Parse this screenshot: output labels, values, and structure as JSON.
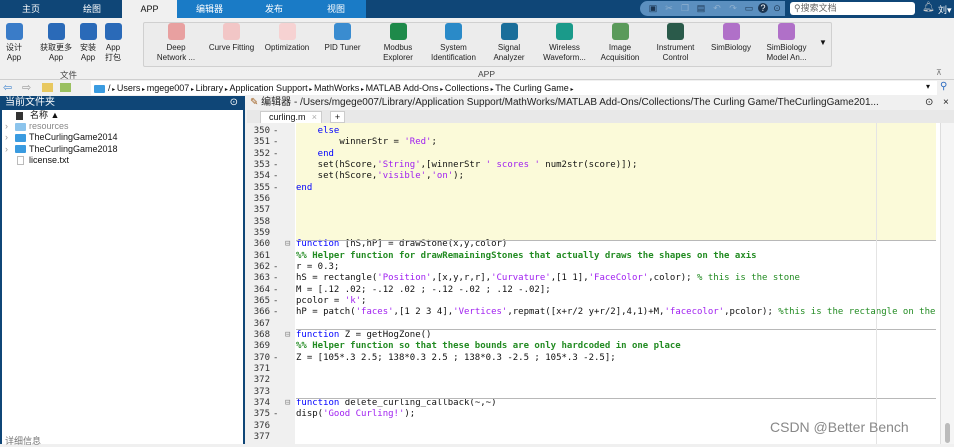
{
  "tabs": {
    "items": [
      "主页",
      "绘图",
      "APP",
      "编辑器",
      "发布",
      "视图"
    ],
    "active": "APP"
  },
  "quick_access": {
    "icons": [
      "save-icon",
      "cut-icon",
      "copy-icon",
      "paste-icon",
      "undo-icon",
      "redo-icon",
      "switch-windows-icon",
      "help-icon",
      "dropdown-icon"
    ]
  },
  "search": {
    "placeholder": "搜索文档"
  },
  "user": {
    "name": "刘"
  },
  "ribbon": {
    "file_group": {
      "label": "文件",
      "buttons": [
        [
          "设计",
          "App"
        ],
        [
          "获取更多 App",
          ""
        ],
        [
          "安装",
          "App"
        ],
        [
          "App",
          "打包"
        ]
      ]
    },
    "app_group": {
      "label": "APP",
      "apps": [
        {
          "l1": "Deep",
          "l2": "Network ...",
          "color": "#e8a0a0"
        },
        {
          "l1": "Curve Fitting",
          "l2": "",
          "color": "#f2c6c6"
        },
        {
          "l1": "Optimization",
          "l2": "",
          "color": "#f6d2d2"
        },
        {
          "l1": "PID Tuner",
          "l2": "",
          "color": "#3a8cd0"
        },
        {
          "l1": "Modbus",
          "l2": "Explorer",
          "color": "#1e8a4a"
        },
        {
          "l1": "System",
          "l2": "Identification",
          "color": "#2a8ac8"
        },
        {
          "l1": "Signal",
          "l2": "Analyzer",
          "color": "#1a6e9a"
        },
        {
          "l1": "Wireless",
          "l2": "Waveform...",
          "color": "#1a9a8a"
        },
        {
          "l1": "Image",
          "l2": "Acquisition",
          "color": "#5a9a5a"
        },
        {
          "l1": "Instrument",
          "l2": "Control",
          "color": "#2a5a4a"
        },
        {
          "l1": "SimBiology",
          "l2": "",
          "color": "#b070c8"
        },
        {
          "l1": "SimBiology",
          "l2": "Model An...",
          "color": "#b070c8"
        }
      ]
    }
  },
  "address": {
    "path": [
      "/",
      "Users",
      "mgege007",
      "Library",
      "Application Support",
      "MathWorks",
      "MATLAB Add-Ons",
      "Collections",
      "The Curling Game"
    ]
  },
  "current_folder": {
    "title": "当前文件夹",
    "column": "名称 ▲",
    "items": [
      {
        "name": "resources",
        "type": "folder",
        "dim": true
      },
      {
        "name": "TheCurlingGame2014",
        "type": "folder"
      },
      {
        "name": "TheCurlingGame2018",
        "type": "folder"
      },
      {
        "name": "license.txt",
        "type": "file"
      }
    ],
    "details_label": "详细信息"
  },
  "editor": {
    "title": "编辑器 - /Users/mgege007/Library/Application Support/MathWorks/MATLAB Add-Ons/Collections/The Curling Game/TheCurlingGame201...",
    "tab": "curling.m",
    "add_tab": "+",
    "lines": [
      {
        "n": "350",
        "d": true,
        "t": [
          [
            "kw",
            "    else"
          ]
        ]
      },
      {
        "n": "351",
        "d": true,
        "t": [
          [
            "",
            "        winnerStr = "
          ],
          [
            "str",
            "'Red'"
          ],
          [
            "",
            ";"
          ]
        ]
      },
      {
        "n": "352",
        "d": true,
        "t": [
          [
            "kw",
            "    end"
          ]
        ]
      },
      {
        "n": "353",
        "d": true,
        "t": [
          [
            "",
            "    set(hScore,"
          ],
          [
            "str",
            "'String'"
          ],
          [
            "",
            ",[winnerStr "
          ],
          [
            "str",
            "' scores '"
          ],
          [
            "",
            " num2str(score)]);"
          ]
        ]
      },
      {
        "n": "354",
        "d": true,
        "t": [
          [
            "",
            "    set(hScore,"
          ],
          [
            "str",
            "'visible'"
          ],
          [
            "",
            ","
          ],
          [
            "str",
            "'on'"
          ],
          [
            "",
            ");"
          ]
        ]
      },
      {
        "n": "355",
        "d": true,
        "t": [
          [
            "kw",
            "end"
          ]
        ]
      },
      {
        "n": "356",
        "d": false,
        "t": []
      },
      {
        "n": "357",
        "d": false,
        "t": []
      },
      {
        "n": "358",
        "d": false,
        "t": []
      },
      {
        "n": "359",
        "d": false,
        "t": []
      },
      {
        "n": "360",
        "d": false,
        "t": [
          [
            "kw",
            "function"
          ],
          [
            "",
            " [hS,hP] = drawStone(x,y,color)"
          ]
        ]
      },
      {
        "n": "361",
        "d": false,
        "t": [
          [
            "cmb",
            "%% Helper function for drawRemainingStones that actually draws the shapes on the axis"
          ]
        ]
      },
      {
        "n": "362",
        "d": true,
        "t": [
          [
            "",
            "r = 0.3;"
          ]
        ]
      },
      {
        "n": "363",
        "d": true,
        "t": [
          [
            "",
            "hS = rectangle("
          ],
          [
            "str",
            "'Position'"
          ],
          [
            "",
            ",[x,y,r,r],"
          ],
          [
            "str",
            "'Curvature'"
          ],
          [
            "",
            ",[1 1],"
          ],
          [
            "str",
            "'FaceColor'"
          ],
          [
            "",
            ",color); "
          ],
          [
            "cm",
            "% this is the stone"
          ]
        ]
      },
      {
        "n": "364",
        "d": true,
        "t": [
          [
            "",
            "M = [.12 .02; -.12 .02 ; -.12 -.02 ; .12 -.02];"
          ]
        ]
      },
      {
        "n": "365",
        "d": true,
        "t": [
          [
            "",
            "pcolor = "
          ],
          [
            "str",
            "'k'"
          ],
          [
            "",
            ";"
          ]
        ]
      },
      {
        "n": "366",
        "d": true,
        "t": [
          [
            "",
            "hP = patch("
          ],
          [
            "str",
            "'faces'"
          ],
          [
            "",
            ",[1 2 3 4],"
          ],
          [
            "str",
            "'Vertices'"
          ],
          [
            "",
            ",repmat([x+r/2 y+r/2],4,1)+M,"
          ],
          [
            "str",
            "'facecolor'"
          ],
          [
            "",
            ",pcolor); "
          ],
          [
            "cm",
            "%this is the rectangle on the st"
          ]
        ]
      },
      {
        "n": "367",
        "d": false,
        "t": []
      },
      {
        "n": "368",
        "d": false,
        "t": [
          [
            "kw",
            "function"
          ],
          [
            "",
            " Z = getHogZone()"
          ]
        ]
      },
      {
        "n": "369",
        "d": false,
        "t": [
          [
            "cmb",
            "%% Helper function so that these bounds are only hardcoded in one place"
          ]
        ]
      },
      {
        "n": "370",
        "d": true,
        "t": [
          [
            "",
            "Z = [105*.3 2.5; 138*0.3 2.5 ; 138*0.3 -2.5 ; 105*.3 -2.5];"
          ]
        ]
      },
      {
        "n": "371",
        "d": false,
        "t": []
      },
      {
        "n": "372",
        "d": false,
        "t": []
      },
      {
        "n": "373",
        "d": false,
        "t": []
      },
      {
        "n": "374",
        "d": false,
        "t": [
          [
            "kw",
            "function"
          ],
          [
            "",
            " delete_curling_callback(~,~)"
          ]
        ]
      },
      {
        "n": "375",
        "d": true,
        "t": [
          [
            "",
            "disp("
          ],
          [
            "str",
            "'Good Curling!'"
          ],
          [
            "",
            ");"
          ]
        ]
      },
      {
        "n": "376",
        "d": false,
        "t": []
      },
      {
        "n": "377",
        "d": false,
        "t": []
      }
    ]
  },
  "watermark": "CSDN @Better Bench",
  "colors": {
    "tabbar": "#0f4677",
    "editor_tabs": "#1a7bc6",
    "keyword": "#0000ff",
    "string": "#a020f0",
    "comment": "#228b22",
    "cell_highlight": "#fbfad9"
  }
}
